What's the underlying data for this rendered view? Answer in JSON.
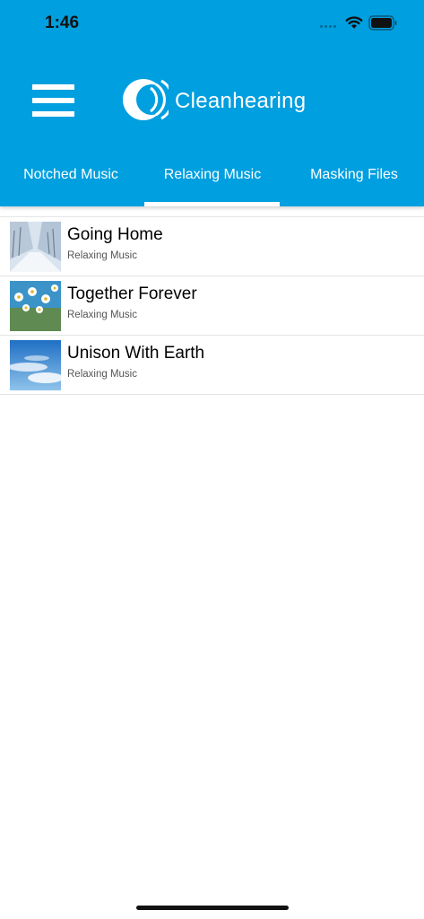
{
  "status_bar": {
    "time": "1:46"
  },
  "header": {
    "brand": "Cleanhearing"
  },
  "tabs": [
    {
      "label": "Notched Music"
    },
    {
      "label": "Relaxing Music",
      "selected": true
    },
    {
      "label": "Masking Files"
    }
  ],
  "tracks": [
    {
      "title": "Going Home",
      "category": "Relaxing Music",
      "thumbnail": "snowy-tree-path"
    },
    {
      "title": "Together Forever",
      "category": "Relaxing Music",
      "thumbnail": "daisies-sky"
    },
    {
      "title": "Unison With Earth",
      "category": "Relaxing Music",
      "thumbnail": "blue-sky-clouds"
    }
  ],
  "colors": {
    "accent": "#009fdf",
    "background": "#ffffff"
  }
}
